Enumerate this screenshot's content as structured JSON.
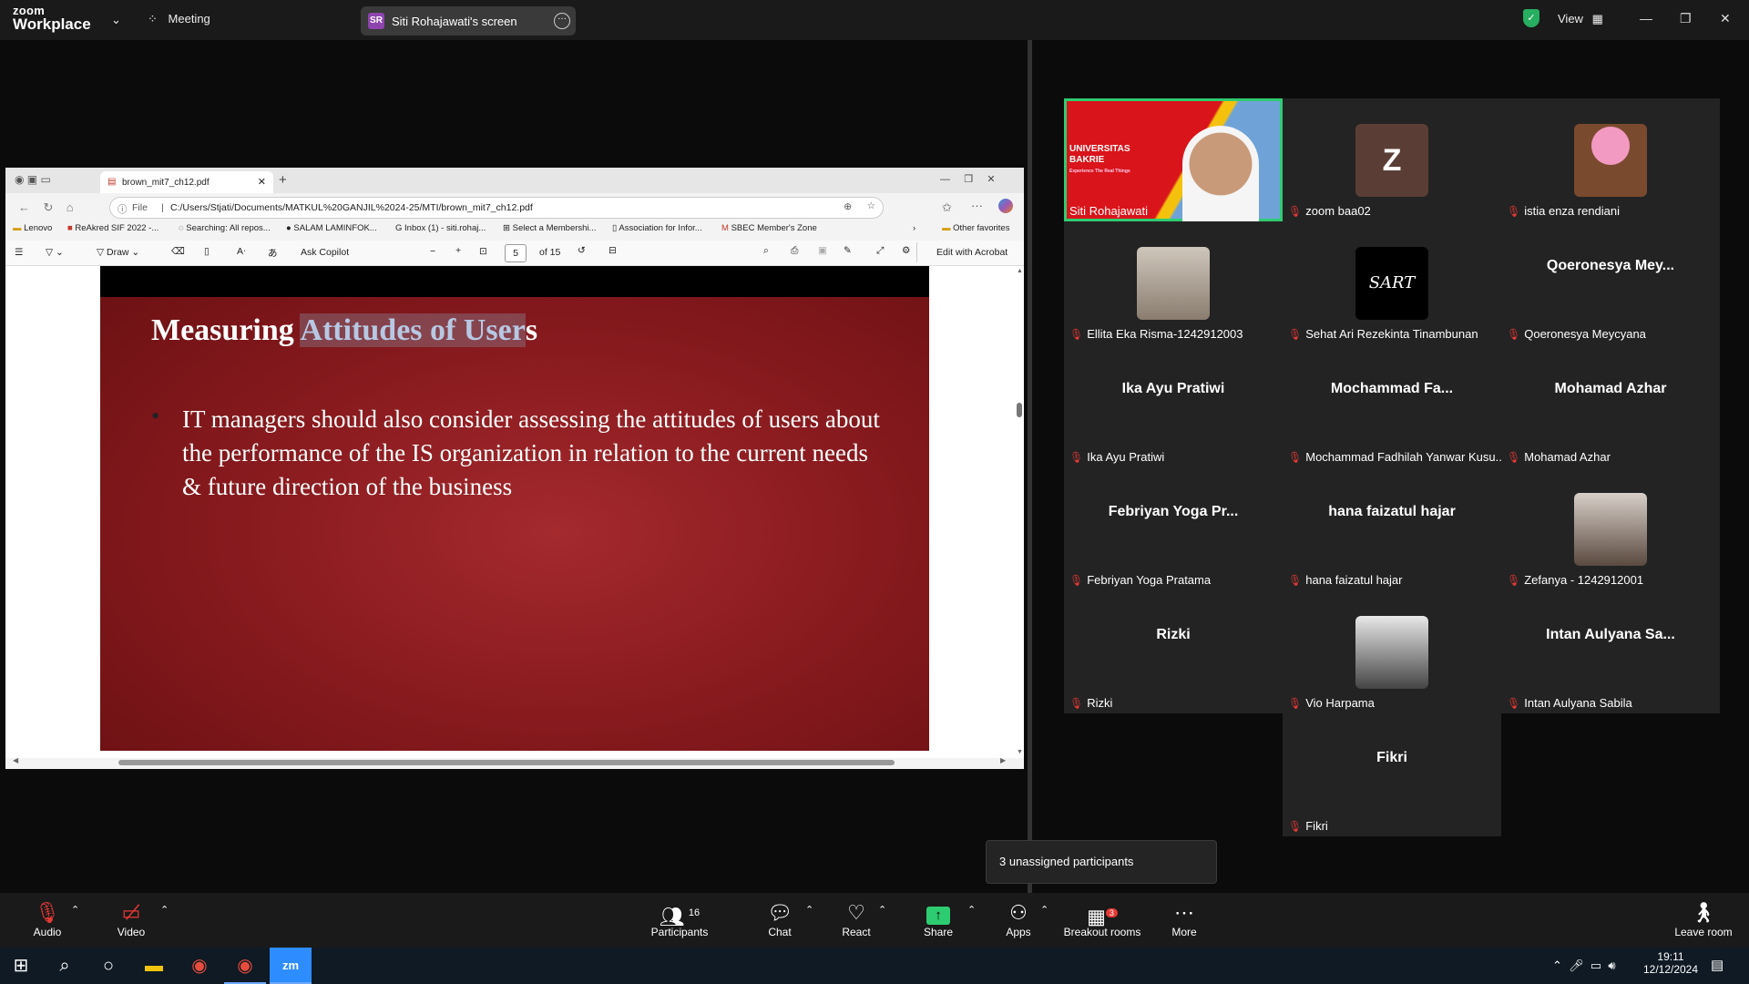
{
  "zoom": {
    "logo_top": "zoom",
    "logo_bottom": "Workplace",
    "meeting_label": "Meeting",
    "share_initials": "SR",
    "share_label": "Siti Rohajawati's screen",
    "view_label": "View",
    "accent_green": "#2ecc71"
  },
  "browser": {
    "tab_title": "brown_mit7_ch12.pdf",
    "file_label": "File",
    "address": "C:/Users/Stjati/Documents/MATKUL%20GANJIL%2024-25/MTI/brown_mit7_ch12.pdf",
    "bookmarks": [
      "Lenovo",
      "ReAkred SIF 2022 -...",
      "Searching: All repos...",
      "SALAM LAMINFOK...",
      "Inbox (1) - siti.rohaj...",
      "Select a Membershi...",
      "Association for Infor...",
      "SBEC Member's Zone"
    ],
    "other_favorites": "Other favorites",
    "pdf_toolbar": {
      "draw": "Draw",
      "ask_copilot": "Ask Copilot",
      "page": "5",
      "of_pages": "of 15",
      "edit_acrobat": "Edit with Acrobat"
    }
  },
  "slide": {
    "title_plain": "Measuring ",
    "title_highlight": "Attitudes of User",
    "title_tail": "s",
    "bullet": "IT managers should also consider assessing the attitudes of users about the performance of the IS organization in relation to the current needs & future direction of the business"
  },
  "participants": [
    {
      "name": "Siti Rohajawati",
      "display": "",
      "kind": "video"
    },
    {
      "name": "zoom baa02",
      "display": "Z",
      "kind": "letter"
    },
    {
      "name": "istia enza rendiani",
      "display": "",
      "kind": "photo"
    },
    {
      "name": "Ellita Eka Risma-1242912003",
      "display": "",
      "kind": "photo"
    },
    {
      "name": "Sehat Ari Rezekinta Tinambunan",
      "display": "SART",
      "kind": "logo"
    },
    {
      "name": "Qoeronesya Meycyana",
      "display": "Qoeronesya  Mey...",
      "kind": "text"
    },
    {
      "name": "Ika Ayu Pratiwi",
      "display": "Ika Ayu Pratiwi",
      "kind": "text"
    },
    {
      "name": "Mochammad Fadhilah Yanwar Kusu...",
      "display": "Mochammad  Fa...",
      "kind": "text"
    },
    {
      "name": "Mohamad Azhar",
      "display": "Mohamad Azhar",
      "kind": "text"
    },
    {
      "name": "Febriyan Yoga Pratama",
      "display": "Febriyan  Yoga  Pr...",
      "kind": "text"
    },
    {
      "name": "hana faizatul hajar",
      "display": "hana faizatul hajar",
      "kind": "text"
    },
    {
      "name": "Zefanya - 1242912001",
      "display": "",
      "kind": "photo"
    },
    {
      "name": "Rizki",
      "display": "Rizki",
      "kind": "text"
    },
    {
      "name": "Vio Harpama",
      "display": "",
      "kind": "photo"
    },
    {
      "name": "Intan Aulyana Sabila",
      "display": "Intan  Aulyana  Sa...",
      "kind": "text"
    },
    {
      "name": "Fikri",
      "display": "Fikri",
      "kind": "text"
    }
  ],
  "video_overlay": {
    "line1": "UNIVERSITAS",
    "line2": "BAKRIE",
    "line3": "Experience The Real Things"
  },
  "unassigned": "3 unassigned participants",
  "toolbar": {
    "audio": "Audio",
    "video": "Video",
    "participants": "Participants",
    "participants_count": "16",
    "chat": "Chat",
    "react": "React",
    "share": "Share",
    "apps": "Apps",
    "breakout": "Breakout rooms",
    "breakout_badge": "3",
    "more": "More",
    "leave": "Leave room"
  },
  "taskbar": {
    "time": "19:11",
    "date": "12/12/2024"
  }
}
